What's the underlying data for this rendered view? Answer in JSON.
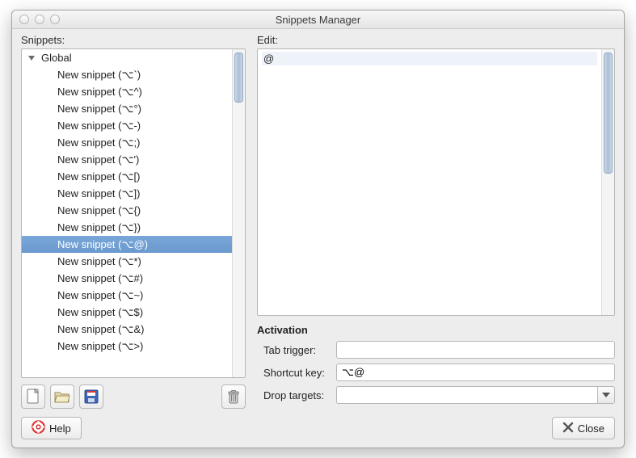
{
  "window": {
    "title": "Snippets Manager"
  },
  "labels": {
    "snippets": "Snippets:",
    "edit": "Edit:",
    "activation": "Activation",
    "tab_trigger": "Tab trigger:",
    "shortcut_key": "Shortcut key:",
    "drop_targets": "Drop targets:"
  },
  "tree": {
    "group": "Global",
    "items": [
      "New snippet (⌥`)",
      "New snippet (⌥^)",
      "New snippet (⌥°)",
      "New snippet (⌥-)",
      "New snippet (⌥;)",
      "New snippet (⌥')",
      "New snippet (⌥[)",
      "New snippet (⌥])",
      "New snippet (⌥{)",
      "New snippet (⌥})",
      "New snippet (⌥@)",
      "New snippet (⌥*)",
      "New snippet (⌥#)",
      "New snippet (⌥~)",
      "New snippet (⌥$)",
      "New snippet (⌥&)",
      "New snippet (⌥>)"
    ],
    "selected_index": 10
  },
  "editor": {
    "content": "@"
  },
  "form": {
    "tab_trigger": "",
    "shortcut_key": "⌥@",
    "drop_targets": ""
  },
  "buttons": {
    "help": "Help",
    "close": "Close"
  }
}
